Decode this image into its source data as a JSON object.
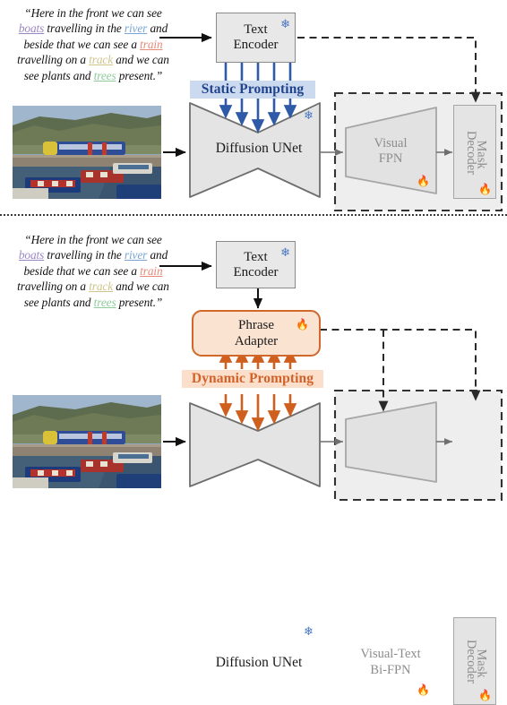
{
  "figure": {
    "panels": [
      {
        "id": "static",
        "name": "Static Prompting pipeline",
        "caption": {
          "open_quote": "“",
          "segments": [
            {
              "text": "Here in the front we can see ",
              "color": null
            },
            {
              "text": "boats",
              "color": "#9b86c4",
              "highlight": true
            },
            {
              "text": " travelling in the ",
              "color": null
            },
            {
              "text": "river",
              "color": "#7aa5d8",
              "highlight": true
            },
            {
              "text": " and beside that we can see a ",
              "color": null
            },
            {
              "text": "train",
              "color": "#e8897a",
              "highlight": true
            },
            {
              "text": " travelling on a ",
              "color": null
            },
            {
              "text": "track",
              "color": "#cfc489",
              "highlight": true
            },
            {
              "text": " and we can see plants and ",
              "color": null
            },
            {
              "text": "trees",
              "color": "#8ecb9a",
              "highlight": true
            },
            {
              "text": " present.",
              "color": null
            }
          ],
          "close_quote": "”",
          "lines": [
            "“Here in the front we can see",
            "boats travelling in the river and",
            "beside that we can see a train",
            "travelling on a track and we can",
            "see plants and trees present.”"
          ]
        },
        "image_alt": "train beside canal with narrowboats",
        "text_encoder": {
          "label_line1": "Text",
          "label_line2": "Encoder",
          "state": "frozen",
          "state_icon": "snowflake-icon"
        },
        "prompting": {
          "label": "Static Prompting",
          "color": "#21438c",
          "background": "#ccdaf0",
          "arrow_color": "#2f5aa8",
          "arrow_count": 5
        },
        "unet": {
          "label": "Diffusion UNet",
          "state": "frozen",
          "state_icon": "snowflake-icon"
        },
        "fpn": {
          "label_line1": "Visual",
          "label_line2": "FPN",
          "state": "trainable",
          "state_icon": "fire-icon"
        },
        "decoder": {
          "label_line1": "Mask",
          "label_line2": "Decoder",
          "state": "trainable",
          "state_icon": "fire-icon"
        }
      },
      {
        "id": "dynamic",
        "name": "Dynamic Prompting pipeline",
        "caption": {
          "lines": [
            "“Here in the front we can see",
            "boats travelling in the river and",
            "beside that we can see a train",
            "travelling on a track and we can",
            "see plants and trees present.”"
          ]
        },
        "image_alt": "train beside canal with narrowboats",
        "text_encoder": {
          "label_line1": "Text",
          "label_line2": "Encoder",
          "state": "frozen",
          "state_icon": "snowflake-icon"
        },
        "adapter": {
          "label_line1": "Phrase",
          "label_line2": "Adapter",
          "state": "trainable",
          "state_icon": "fire-icon",
          "border_color": "#d2672a",
          "background": "#fbe3d2"
        },
        "prompting": {
          "label": "Dynamic Prompting",
          "color": "#d2622a",
          "background": "#fbdfcb",
          "arrow_color": "#cf5f1e",
          "arrow_count": 5
        },
        "unet": {
          "label": "Diffusion UNet",
          "state": "frozen",
          "state_icon": "snowflake-icon"
        },
        "fpn": {
          "label_line1": "Visual-Text",
          "label_line2": "Bi-FPN",
          "state": "trainable",
          "state_icon": "fire-icon"
        },
        "decoder": {
          "label_line1": "Mask",
          "label_line2": "Decoder",
          "state": "trainable",
          "state_icon": "fire-icon"
        }
      }
    ],
    "icons": {
      "snowflake": "❄",
      "fire": "🔥"
    },
    "colors": {
      "frozen": "#4a77c4",
      "trainable": "#e8762c",
      "static_accent": "#21438c",
      "dynamic_accent": "#d2622a",
      "box_fill": "#e8e8e8",
      "box_stroke": "#8a8a8a",
      "dashed_stroke": "#333333",
      "grey_text": "#8d8d8d"
    }
  }
}
